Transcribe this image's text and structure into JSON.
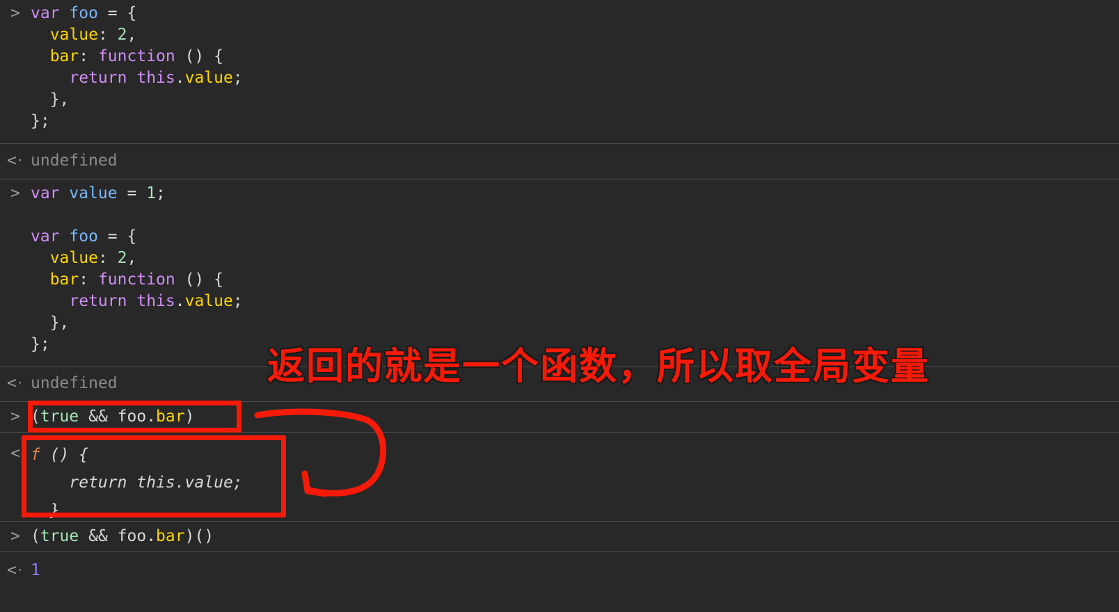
{
  "theme": {
    "background": "#282828",
    "divider": "#4d4d4d",
    "annotation_red": "#f61a09",
    "keyword": "#cf8ef4",
    "identifier": "#79b8ff",
    "property_key": "#ffd600",
    "number": "#a5e3b8",
    "plain_text": "#d8d8d8",
    "muted_text": "#8a8a8a",
    "function_glyph": "#e8834a",
    "primitive_result": "#8c7bf0"
  },
  "markers": {
    "input_prompt": ">",
    "output_prompt": "<",
    "output_dot": "·"
  },
  "entries": [
    {
      "id": "entry-1-input",
      "kind": "input",
      "marker": ">",
      "lines": [
        [
          {
            "t": "var ",
            "c": "kw"
          },
          {
            "t": "foo",
            "c": "prop"
          },
          {
            "t": " = {",
            "c": "punc"
          }
        ],
        [
          {
            "t": "  ",
            "c": "punc"
          },
          {
            "t": "value",
            "c": "key"
          },
          {
            "t": ": ",
            "c": "punc"
          },
          {
            "t": "2",
            "c": "num"
          },
          {
            "t": ",",
            "c": "punc"
          }
        ],
        [
          {
            "t": "  ",
            "c": "punc"
          },
          {
            "t": "bar",
            "c": "key"
          },
          {
            "t": ": ",
            "c": "punc"
          },
          {
            "t": "function",
            "c": "kw"
          },
          {
            "t": " () {",
            "c": "punc"
          }
        ],
        [
          {
            "t": "    ",
            "c": "punc"
          },
          {
            "t": "return",
            "c": "kw"
          },
          {
            "t": " ",
            "c": "punc"
          },
          {
            "t": "this",
            "c": "kw"
          },
          {
            "t": ".",
            "c": "punc"
          },
          {
            "t": "value",
            "c": "key"
          },
          {
            "t": ";",
            "c": "punc"
          }
        ],
        [
          {
            "t": "  },",
            "c": "punc"
          }
        ],
        [
          {
            "t": "};",
            "c": "punc"
          }
        ]
      ]
    },
    {
      "id": "entry-1-output",
      "kind": "output",
      "marker": "<",
      "lines": [
        [
          {
            "t": "undefined",
            "c": "dim"
          }
        ]
      ]
    },
    {
      "id": "entry-2-input",
      "kind": "input",
      "marker": ">",
      "lines": [
        [
          {
            "t": "var ",
            "c": "kw"
          },
          {
            "t": "value",
            "c": "prop"
          },
          {
            "t": " = ",
            "c": "punc"
          },
          {
            "t": "1",
            "c": "num"
          },
          {
            "t": ";",
            "c": "punc"
          }
        ],
        [
          {
            "t": "",
            "c": "punc"
          }
        ],
        [
          {
            "t": "var ",
            "c": "kw"
          },
          {
            "t": "foo",
            "c": "prop"
          },
          {
            "t": " = {",
            "c": "punc"
          }
        ],
        [
          {
            "t": "  ",
            "c": "punc"
          },
          {
            "t": "value",
            "c": "key"
          },
          {
            "t": ": ",
            "c": "punc"
          },
          {
            "t": "2",
            "c": "num"
          },
          {
            "t": ",",
            "c": "punc"
          }
        ],
        [
          {
            "t": "  ",
            "c": "punc"
          },
          {
            "t": "bar",
            "c": "key"
          },
          {
            "t": ": ",
            "c": "punc"
          },
          {
            "t": "function",
            "c": "kw"
          },
          {
            "t": " () {",
            "c": "punc"
          }
        ],
        [
          {
            "t": "    ",
            "c": "punc"
          },
          {
            "t": "return",
            "c": "kw"
          },
          {
            "t": " ",
            "c": "punc"
          },
          {
            "t": "this",
            "c": "kw"
          },
          {
            "t": ".",
            "c": "punc"
          },
          {
            "t": "value",
            "c": "key"
          },
          {
            "t": ";",
            "c": "punc"
          }
        ],
        [
          {
            "t": "  },",
            "c": "punc"
          }
        ],
        [
          {
            "t": "};",
            "c": "punc"
          }
        ]
      ]
    },
    {
      "id": "entry-2-output",
      "kind": "output",
      "marker": "<",
      "lines": [
        [
          {
            "t": "undefined",
            "c": "dim"
          }
        ]
      ]
    },
    {
      "id": "entry-3-input",
      "kind": "input",
      "marker": ">",
      "lines": [
        [
          {
            "t": "(",
            "c": "punc"
          },
          {
            "t": "true",
            "c": "num"
          },
          {
            "t": " && ",
            "c": "punc"
          },
          {
            "t": "foo",
            "c": "plain"
          },
          {
            "t": ".",
            "c": "punc"
          },
          {
            "t": "bar",
            "c": "key"
          },
          {
            "t": ")",
            "c": "punc"
          }
        ]
      ]
    },
    {
      "id": "entry-3-output",
      "kind": "output-function",
      "marker": "<",
      "lines": [
        [
          {
            "t": "f",
            "c": "fglyph"
          },
          {
            "t": " () {",
            "c": "fnresult"
          }
        ],
        [
          {
            "t": "    return this.value;",
            "c": "fnresult"
          }
        ],
        [
          {
            "t": "  }",
            "c": "fnresult"
          }
        ]
      ]
    },
    {
      "id": "entry-4-input",
      "kind": "input",
      "marker": ">",
      "lines": [
        [
          {
            "t": "(",
            "c": "punc"
          },
          {
            "t": "true",
            "c": "num"
          },
          {
            "t": " && ",
            "c": "punc"
          },
          {
            "t": "foo",
            "c": "plain"
          },
          {
            "t": ".",
            "c": "punc"
          },
          {
            "t": "bar",
            "c": "key"
          },
          {
            "t": ")()",
            "c": "punc"
          }
        ]
      ]
    },
    {
      "id": "entry-4-output",
      "kind": "output",
      "marker": "<",
      "lines": [
        [
          {
            "t": "1",
            "c": "blueval"
          }
        ]
      ]
    }
  ],
  "annotations": {
    "note_text": "返回的就是一个函数，所以取全局变量",
    "highlight_expression_box_label": "(true && foo.bar)",
    "highlight_result_box_label": "f () { return this.value; }",
    "arrow_label": "curved-arrow-pointing-to-function-result"
  }
}
